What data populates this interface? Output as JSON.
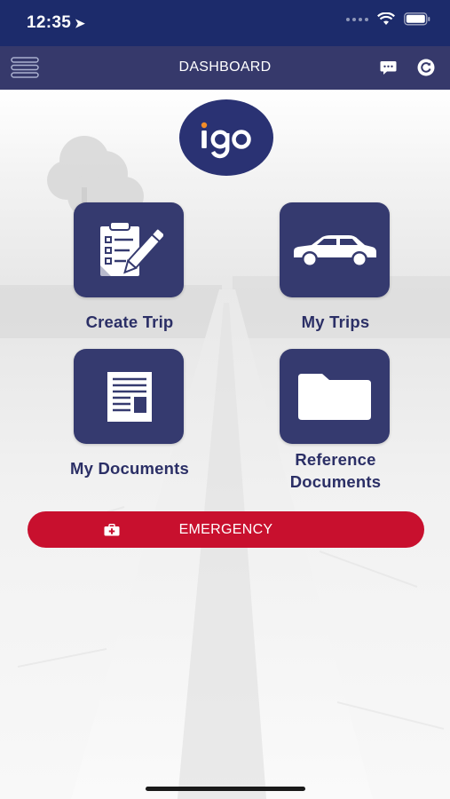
{
  "status": {
    "time": "12:35"
  },
  "nav": {
    "title": "DASHBOARD"
  },
  "logo": {
    "text": "igo"
  },
  "tiles": [
    {
      "label": "Create Trip",
      "icon": "clipboard-pen-icon"
    },
    {
      "label": "My Trips",
      "icon": "car-icon"
    },
    {
      "label": "My Documents",
      "icon": "document-icon"
    },
    {
      "label_line1": "Reference",
      "label_line2": "Documents",
      "icon": "folder-icon"
    }
  ],
  "emergency": {
    "label": "EMERGENCY",
    "icon": "first-aid-kit-icon"
  },
  "colors": {
    "status_bar": "#1c2b6b",
    "nav_bar": "#36396b",
    "tile": "#353a6f",
    "tile_label": "#2b2f66",
    "emergency": "#c8102e"
  }
}
